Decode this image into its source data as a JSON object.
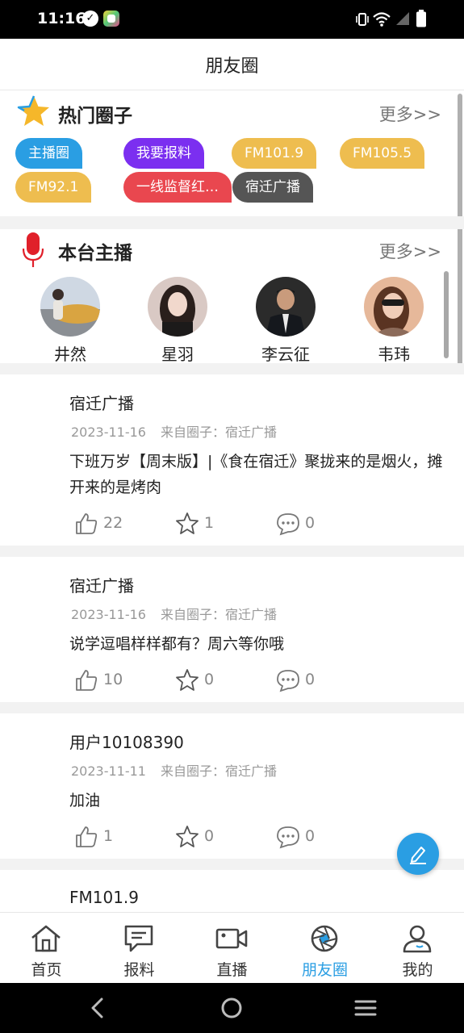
{
  "status_bar": {
    "time": "11:16"
  },
  "header": {
    "title": "朋友圈"
  },
  "hot_circles": {
    "title": "热门圈子",
    "more": "更多>>",
    "tags": [
      {
        "label": "主播圈",
        "color": "#2a9ee3"
      },
      {
        "label": "我要报料",
        "color": "#7b2ff0"
      },
      {
        "label": "FM101.9",
        "color": "#eebd4f"
      },
      {
        "label": "FM105.5",
        "color": "#eebd4f"
      },
      {
        "label": "FM92.1",
        "color": "#eebd4f"
      },
      {
        "label": "一线监督红…",
        "color": "#e9474f"
      },
      {
        "label": "宿迁广播",
        "color": "#555555"
      }
    ]
  },
  "anchors": {
    "title": "本台主播",
    "more": "更多>>",
    "items": [
      {
        "name": "井然"
      },
      {
        "name": "星羽"
      },
      {
        "name": "李云征"
      },
      {
        "name": "韦玮"
      }
    ]
  },
  "posts": [
    {
      "author": "宿迁广播",
      "date": "2023-11-16",
      "source": "来自圈子：宿迁广播",
      "content": "下班万岁【周末版】|《食在宿迁》聚拢来的是烟火，摊开来的是烤肉",
      "likes": "22",
      "favorites": "1",
      "comments": "0"
    },
    {
      "author": "宿迁广播",
      "date": "2023-11-16",
      "source": "来自圈子：宿迁广播",
      "content": "说学逗唱样样都有？周六等你哦",
      "likes": "10",
      "favorites": "0",
      "comments": "0"
    },
    {
      "author": "用户10108390",
      "date": "2023-11-11",
      "source": "来自圈子：宿迁广播",
      "content": "加油",
      "likes": "1",
      "favorites": "0",
      "comments": "0"
    },
    {
      "author": "FM101.9"
    }
  ],
  "bottom_nav": [
    {
      "label": "首页",
      "icon": "home-icon"
    },
    {
      "label": "报料",
      "icon": "report-icon"
    },
    {
      "label": "直播",
      "icon": "video-camera-icon"
    },
    {
      "label": "朋友圈",
      "icon": "aperture-icon",
      "active": true
    },
    {
      "label": "我的",
      "icon": "user-icon"
    }
  ],
  "colors": {
    "accent": "#2a9ee3",
    "mic_red": "#e0202a",
    "star_gold": "#f5b72a"
  }
}
